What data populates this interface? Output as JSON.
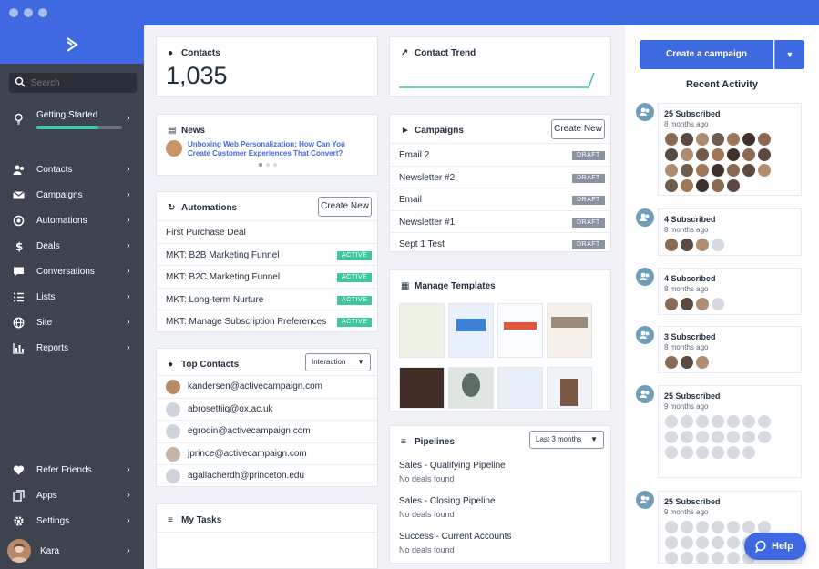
{
  "sidebar": {
    "search_placeholder": "Search",
    "getting_started": {
      "label": "Getting Started",
      "progress": 0.72
    },
    "items": [
      {
        "label": "Contacts",
        "icon": "contacts-icon"
      },
      {
        "label": "Campaigns",
        "icon": "envelope-icon"
      },
      {
        "label": "Automations",
        "icon": "automation-icon"
      },
      {
        "label": "Deals",
        "icon": "dollar-icon"
      },
      {
        "label": "Conversations",
        "icon": "chat-icon"
      },
      {
        "label": "Lists",
        "icon": "list-icon"
      },
      {
        "label": "Site",
        "icon": "globe-icon"
      },
      {
        "label": "Reports",
        "icon": "bar-chart-icon"
      }
    ],
    "bottom": [
      {
        "label": "Refer Friends",
        "icon": "heart-icon"
      },
      {
        "label": "Apps",
        "icon": "apps-icon"
      },
      {
        "label": "Settings",
        "icon": "gear-icon"
      }
    ],
    "user": {
      "name": "Kara"
    }
  },
  "contacts": {
    "title": "Contacts",
    "count": "1,035"
  },
  "contact_trend": {
    "title": "Contact Trend"
  },
  "news": {
    "title": "News",
    "headline": "Unboxing Web Personalization: How Can You Create Customer Experiences That Convert?"
  },
  "campaigns": {
    "title": "Campaigns",
    "create_label": "Create New",
    "rows": [
      {
        "name": "Email 2",
        "status": "DRAFT"
      },
      {
        "name": "Newsletter #2",
        "status": "DRAFT"
      },
      {
        "name": "Email",
        "status": "DRAFT"
      },
      {
        "name": "Newsletter #1",
        "status": "DRAFT"
      },
      {
        "name": "Sept 1 Test",
        "status": "DRAFT"
      }
    ]
  },
  "automations": {
    "title": "Automations",
    "create_label": "Create New",
    "rows": [
      {
        "name": "First Purchase Deal",
        "status": ""
      },
      {
        "name": "MKT: B2B Marketing Funnel",
        "status": "ACTIVE"
      },
      {
        "name": "MKT: B2C Marketing Funnel",
        "status": "ACTIVE"
      },
      {
        "name": "MKT: Long-term Nurture",
        "status": "ACTIVE"
      },
      {
        "name": "MKT: Manage Subscription Preferences",
        "status": "ACTIVE"
      }
    ]
  },
  "manage_templates": {
    "title": "Manage Templates"
  },
  "top_contacts": {
    "title": "Top Contacts",
    "filter": "Interaction",
    "rows": [
      "kandersen@activecampaign.com",
      "abrosettiiq@ox.ac.uk",
      "egrodin@activecampaign.com",
      "jprince@activecampaign.com",
      "agallacherdh@princeton.edu"
    ]
  },
  "pipelines": {
    "title": "Pipelines",
    "filter": "Last 3 months",
    "rows": [
      {
        "name": "Sales - Qualifying Pipeline",
        "status": "No deals found"
      },
      {
        "name": "Sales - Closing Pipeline",
        "status": "No deals found"
      },
      {
        "name": "Success - Current Accounts",
        "status": "No deals found"
      }
    ]
  },
  "my_tasks": {
    "title": "My Tasks"
  },
  "right": {
    "create_campaign": "Create a campaign",
    "recent_activity": "Recent Activity",
    "activities": [
      {
        "title": "25 Subscribed",
        "time": "8 months ago"
      },
      {
        "title": "4 Subscribed",
        "time": "8 months ago"
      },
      {
        "title": "4 Subscribed",
        "time": "8 months ago"
      },
      {
        "title": "3 Subscribed",
        "time": "8 months ago"
      },
      {
        "title": "25 Subscribed",
        "time": "9 months ago"
      },
      {
        "title": "25 Subscribed",
        "time": "9 months ago"
      }
    ]
  },
  "help": {
    "label": "Help"
  },
  "colors": {
    "brand": "#3e69e0",
    "sidebar": "#3d4450",
    "active": "#3ec8a0",
    "draft": "#8a93a0"
  }
}
